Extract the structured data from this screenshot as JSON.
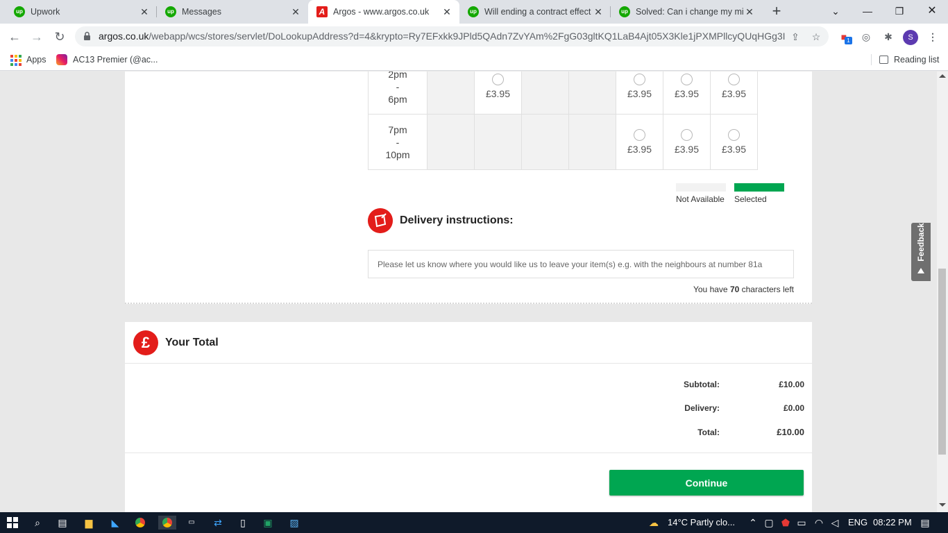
{
  "browser": {
    "tabs": [
      {
        "title": "Upwork",
        "favicon": "upwork-icon"
      },
      {
        "title": "Messages",
        "favicon": "upwork-icon"
      },
      {
        "title": "Argos - www.argos.co.uk",
        "favicon": "argos-icon"
      },
      {
        "title": "Will ending a contract effect",
        "favicon": "upwork-icon"
      },
      {
        "title": "Solved: Can i change my min",
        "favicon": "upwork-icon"
      }
    ],
    "url_host": "argos.co.uk",
    "url_path": "/webapp/wcs/stores/servlet/DoLookupAddress?d=4&krypto=Ry7EFxkk9JPld5QAdn7ZvYAm%2FgG03gltKQ1LaB4Ajt05X3Kle1jPXMPllcyQUqHGg3I...",
    "extension_badge": "1",
    "profile_initial": "S",
    "bookmarks": [
      {
        "label": "Apps",
        "icon": "apps-grid-icon"
      },
      {
        "label": "AC13 Premier (@ac...",
        "icon": "instagram-icon"
      }
    ],
    "reading_list": "Reading list"
  },
  "delivery_slots": {
    "rows": [
      {
        "time_lines": [
          "2pm",
          "-",
          "6pm"
        ],
        "cells": [
          {
            "available": false,
            "price": ""
          },
          {
            "available": true,
            "price": "£3.95"
          },
          {
            "available": false,
            "price": ""
          },
          {
            "available": false,
            "price": ""
          },
          {
            "available": true,
            "price": "£3.95"
          },
          {
            "available": true,
            "price": "£3.95"
          },
          {
            "available": true,
            "price": "£3.95"
          }
        ]
      },
      {
        "time_lines": [
          "7pm",
          "-",
          "10pm"
        ],
        "cells": [
          {
            "available": false,
            "price": ""
          },
          {
            "available": false,
            "price": ""
          },
          {
            "available": false,
            "price": ""
          },
          {
            "available": false,
            "price": ""
          },
          {
            "available": true,
            "price": "£3.95"
          },
          {
            "available": true,
            "price": "£3.95"
          },
          {
            "available": true,
            "price": "£3.95"
          }
        ]
      }
    ],
    "legend": {
      "not_available_label": "Not Available",
      "not_available_color": "#f2f2f2",
      "selected_label": "Selected",
      "selected_color": "#00a651"
    }
  },
  "instructions": {
    "title": "Delivery instructions:",
    "placeholder": "Please let us know where you would like us to leave your item(s) e.g. with the neighbours at number 81a",
    "chars_left_prefix": "You have ",
    "chars_left_count": "70",
    "chars_left_suffix": " characters left"
  },
  "total": {
    "title": "Your Total",
    "icon_symbol": "£",
    "subtotal_label": "Subtotal:",
    "subtotal_value": "£10.00",
    "delivery_label": "Delivery:",
    "delivery_value": "£0.00",
    "total_label": "Total:",
    "total_value": "£10.00",
    "continue_label": "Continue"
  },
  "feedback_label": "Feedback",
  "taskbar": {
    "weather": "14°C  Partly clo...",
    "language": "ENG",
    "time": "08:22 PM"
  },
  "colors": {
    "argos_red": "#e31d1a",
    "continue_green": "#00a651",
    "upwork_green": "#14a800"
  }
}
